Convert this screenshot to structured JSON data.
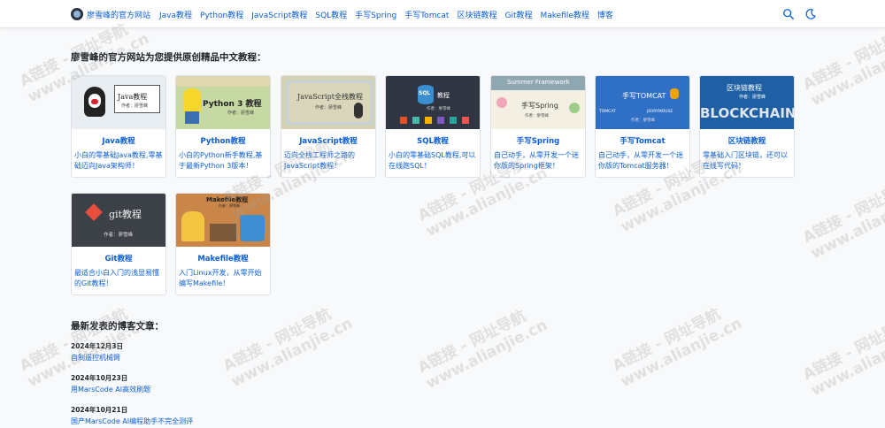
{
  "nav": {
    "brand": "廖雪峰的官方网站",
    "links": [
      "Java教程",
      "Python教程",
      "JavaScript教程",
      "SQL教程",
      "手写Spring",
      "手写Tomcat",
      "区块链教程",
      "Git教程",
      "Makefile教程",
      "博客"
    ]
  },
  "tutorials": {
    "heading": "廖雪峰的官方网站为您提供原创精品中文教程：",
    "cards": [
      {
        "title": "Java教程",
        "desc": "小白的零基础Java教程,零基础迈向Java架构师！",
        "img_text": "Java教程",
        "img_sub": "作者：廖雪峰"
      },
      {
        "title": "Python教程",
        "desc": "小白的Python新手教程,基于最新Python 3版本！",
        "img_text": "Python 3 教程",
        "img_sub": "作者：廖雪峰"
      },
      {
        "title": "JavaScript教程",
        "desc": "迈向全栈工程师之路的JavaScript教程！",
        "img_text": "JavaScript全栈教程",
        "img_sub": "作者：廖雪峰"
      },
      {
        "title": "SQL教程",
        "desc": "小白的零基础SQL教程,可以在线跑SQL！",
        "img_text": "SQL",
        "img_text2": "教程",
        "img_sub": "作者：廖雪峰"
      },
      {
        "title": "手写Spring",
        "desc": "自己动手，从零开发一个迷你版的Spring框架！",
        "img_text": "Summer Framework",
        "img_text2": "手写Spring",
        "img_sub": "作者：廖雪峰"
      },
      {
        "title": "手写Tomcat",
        "desc": "自己动手，从零开发一个迷你版的Tomcat服务器！",
        "img_text": "手写TOMCAT",
        "img_text2": "TOMCAT",
        "img_text3": "JERRYMOUSE",
        "img_sub": "作者：廖雪峰"
      },
      {
        "title": "区块链教程",
        "desc": "零基础入门区块链，还可以在线写代码！",
        "img_text": "区块链教程",
        "img_text2": "BLOCKCHAIN",
        "img_sub": "作者：廖雪峰"
      },
      {
        "title": "Git教程",
        "desc": "最适合小白入门的浅显易懂的Git教程！",
        "img_text": "git教程",
        "img_sub": "作者：廖雪峰"
      },
      {
        "title": "Makefile教程",
        "desc": "入门Linux开发，从零开始编写Makefile！",
        "img_text": "Makefile教程",
        "img_sub": "作者：廖雪峰"
      }
    ]
  },
  "blog": {
    "heading": "最新发表的博客文章：",
    "posts": [
      {
        "date": "2024年12月3日",
        "title": "自制遥控机械臂"
      },
      {
        "date": "2024年10月23日",
        "title": "用MarsCode AI高效刷题"
      },
      {
        "date": "2024年10月21日",
        "title": "国产MarsCode AI编程助手不完全测评"
      }
    ]
  },
  "watermark": {
    "line1": "A链接 - 网址导航",
    "line2": "www.alianjie.cn"
  },
  "colors": {
    "link": "#0b5ed7",
    "background": "#f8f9fa"
  }
}
